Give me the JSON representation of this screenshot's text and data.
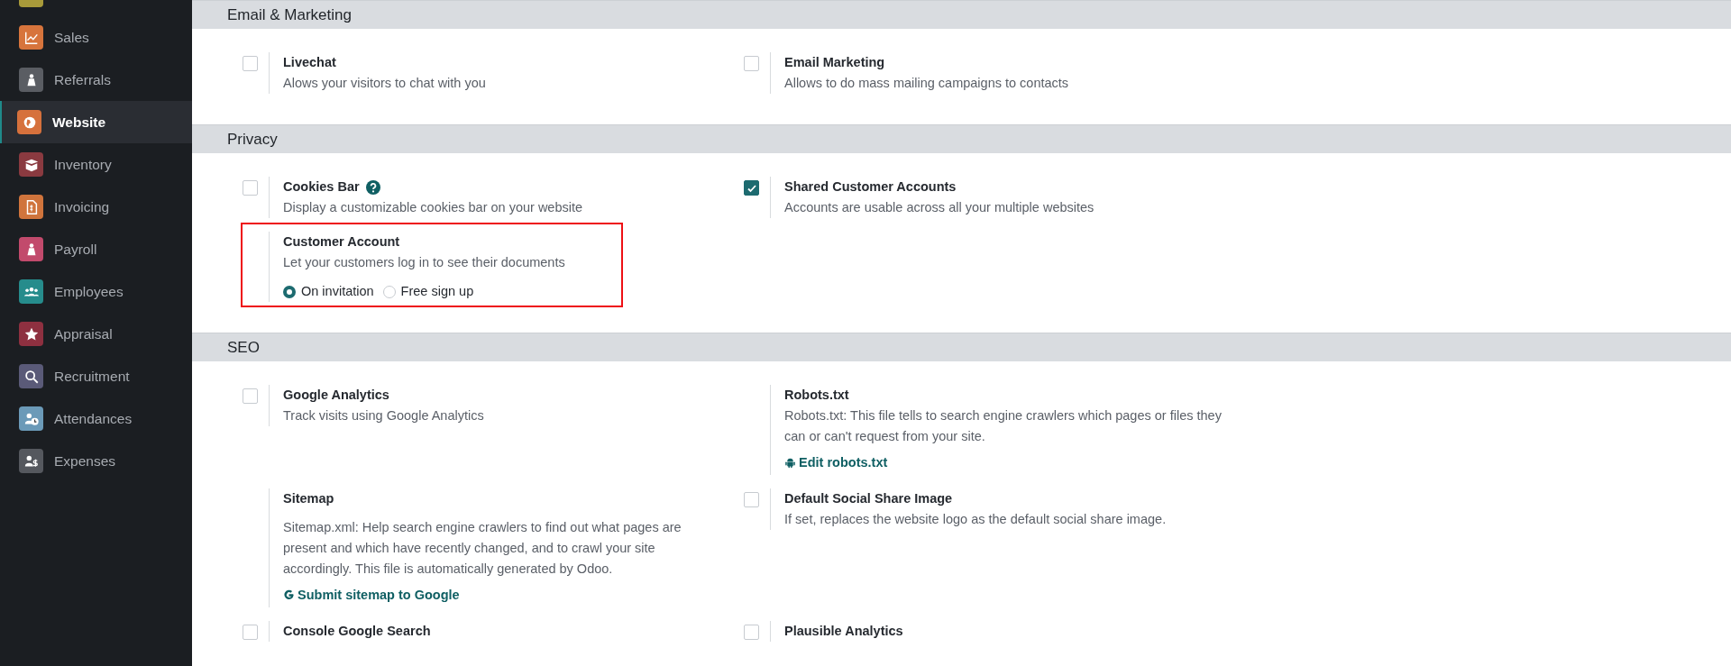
{
  "sidebar": {
    "items": [
      {
        "color": "#a89a3a",
        "selected": false
      },
      {
        "label": "Sales",
        "color": "#d7743c",
        "selected": false
      },
      {
        "label": "Referrals",
        "color": "#5a5d63",
        "selected": false
      },
      {
        "label": "Website",
        "color": "#d6713c",
        "selected": true
      },
      {
        "label": "Inventory",
        "color": "#8a3a40",
        "selected": false
      },
      {
        "label": "Invoicing",
        "color": "#d0743c",
        "selected": false
      },
      {
        "label": "Payroll",
        "color": "#c24a6c",
        "selected": false
      },
      {
        "label": "Employees",
        "color": "#268c8c",
        "selected": false
      },
      {
        "label": "Appraisal",
        "color": "#8e3040",
        "selected": false
      },
      {
        "label": "Recruitment",
        "color": "#5a5a78",
        "selected": false
      },
      {
        "label": "Attendances",
        "color": "#6b9ab8",
        "selected": false
      },
      {
        "label": "Expenses",
        "color": "#55585e",
        "selected": false
      }
    ]
  },
  "sections": [
    {
      "title": "Email & Marketing",
      "settings": [
        {
          "kind": "checkbox",
          "title": "Livechat",
          "checked": false,
          "description": "Alows your visitors to chat with you"
        },
        {
          "kind": "checkbox",
          "title": "Email Marketing",
          "checked": false,
          "description": "Allows to do mass mailing campaigns to contacts"
        }
      ]
    },
    {
      "title": "Privacy",
      "settings": [
        {
          "kind": "checkbox",
          "title": "Cookies Bar",
          "checked": false,
          "help": true,
          "description": "Display a customizable cookies bar on your website"
        },
        {
          "kind": "checkbox",
          "title": "Shared Customer Accounts",
          "checked": true,
          "description": "Accounts are usable across all your multiple websites"
        },
        {
          "kind": "radio",
          "title": "Customer Account",
          "highlighted": true,
          "description": "Let your customers log in to see their documents",
          "options": [
            {
              "label": "On invitation",
              "selected": true
            },
            {
              "label": "Free sign up",
              "selected": false
            }
          ]
        }
      ]
    },
    {
      "title": "SEO",
      "settings": [
        {
          "kind": "checkbox",
          "title": "Google Analytics",
          "checked": false,
          "description": "Track visits using Google Analytics"
        },
        {
          "kind": "plain",
          "title": "Robots.txt",
          "description": "Robots.txt: This file tells to search engine crawlers which pages or files they can or can't request from your site.",
          "link": "Edit robots.txt"
        },
        {
          "kind": "plain",
          "title": "Sitemap",
          "description": "Sitemap.xml: Help search engine crawlers to find out what pages are present and which have recently changed, and to crawl your site accordingly. This file is automatically generated by Odoo.",
          "link": "Submit sitemap to Google"
        },
        {
          "kind": "checkbox",
          "title": "Default Social Share Image",
          "checked": false,
          "description": "If set, replaces the website logo as the default social share image."
        },
        {
          "kind": "checkbox",
          "title": "Console Google Search",
          "checked": false
        },
        {
          "kind": "checkbox",
          "title": "Plausible Analytics",
          "checked": false
        }
      ]
    }
  ]
}
